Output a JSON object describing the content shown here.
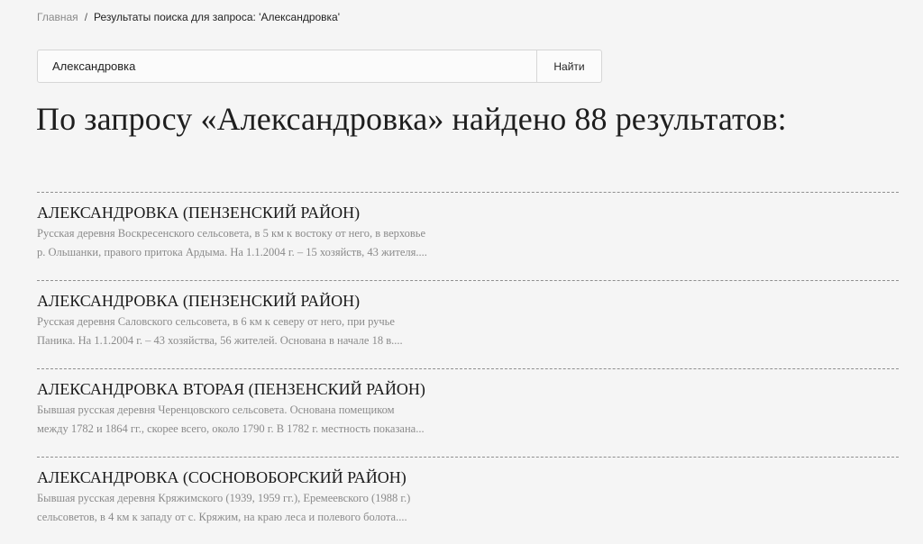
{
  "breadcrumb": {
    "home": "Главная",
    "separator": "/",
    "current": "Результаты поиска для запроса: 'Александровка'"
  },
  "search": {
    "value": "Александровка",
    "button_label": "Найти"
  },
  "heading": "По запросу «Александровка» найдено 88 результатов:",
  "results": [
    {
      "title": "АЛЕКСАНДРОВКА (ПЕНЗЕНСКИЙ РАЙОН)",
      "snippet_lines": [
        "Русская деревня Воскресенского сельсовета, в 5 км к востоку от него, в верховье",
        "р. Ольшанки, правого притока Ардыма. На 1.1.2004 г. – 15 хозяйств, 43 жителя...."
      ]
    },
    {
      "title": "АЛЕКСАНДРОВКА (ПЕНЗЕНСКИЙ РАЙОН)",
      "snippet_lines": [
        "Русская деревня Саловского сельсовета, в 6 км к северу от него, при ручье",
        "Паника. На 1.1.2004 г. – 43 хозяйства, 56 жителей. Основана в начале 18 в...."
      ]
    },
    {
      "title": "АЛЕКСАНДРОВКА ВТОРАЯ (ПЕНЗЕНСКИЙ РАЙОН)",
      "snippet_lines": [
        "Бывшая русская деревня Черенцовского сельсовета. Основана помещиком",
        "между 1782 и 1864 гг., скорее всего, около 1790 г. В 1782 г. местность показана..."
      ]
    },
    {
      "title": "АЛЕКСАНДРОВКА (СОСНОВОБОРСКИЙ РАЙОН)",
      "snippet_lines": [
        "Бывшая русская деревня Кряжимского (1939, 1959 гг.), Еремеевского (1988 г.)",
        "сельсоветов, в 4 км к западу от с. Кряжим, на краю леса и полевого болота...."
      ]
    }
  ]
}
